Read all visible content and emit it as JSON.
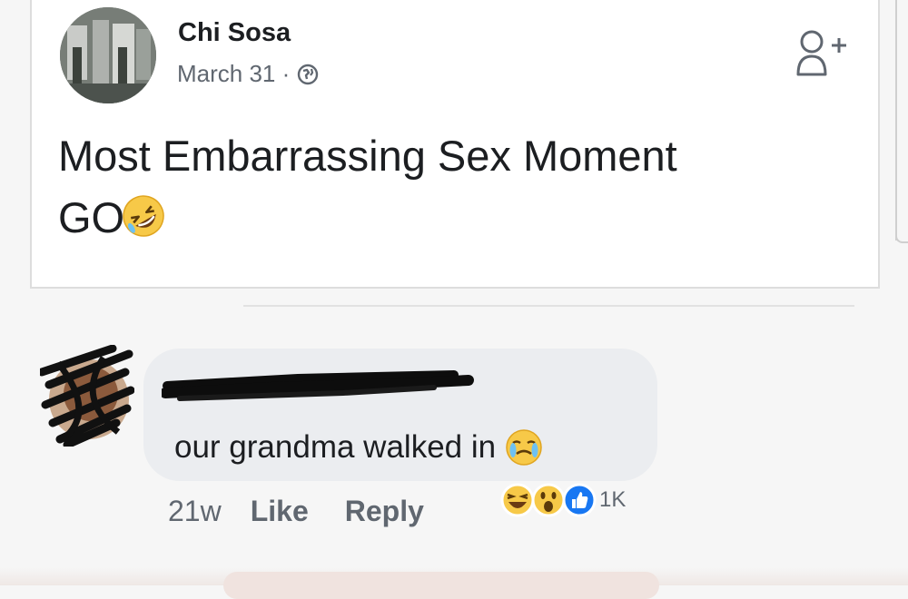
{
  "post": {
    "author": "Chi Sosa",
    "date": "March 31 ·",
    "text": "Most Embarrassing Sex Moment GO",
    "icons": {
      "privacy": "globe-icon",
      "action": "add-friend-icon",
      "emoji": "rolling-laughing-emoji"
    }
  },
  "comment": {
    "text": "our grandma walked in",
    "time": "21w",
    "like_label": "Like",
    "reply_label": "Reply",
    "reaction_count": "1K",
    "reactions": [
      "haha-reaction-icon",
      "wow-reaction-icon",
      "like-reaction-icon"
    ],
    "emoji": "crying-laughing-emoji"
  },
  "colors": {
    "bubble": "#ebedf0",
    "text": "#1c1e21",
    "secondary": "#606770",
    "like_blue": "#1877f2",
    "emoji_yellow": "#f7c948"
  }
}
